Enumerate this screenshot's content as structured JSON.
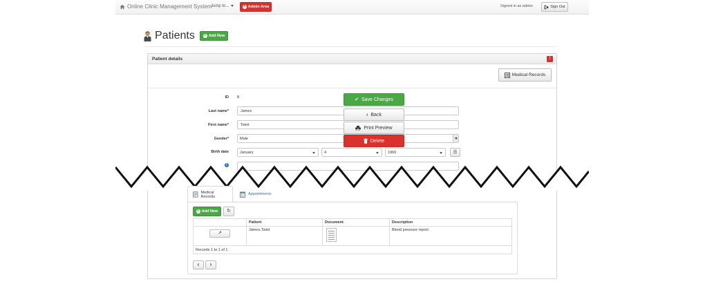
{
  "navbar": {
    "brand": "Online Clinic Management System",
    "jump_label": "Jump to...",
    "admin_label": "Admin Area",
    "signed_in": "Signed in as admin",
    "sign_out": "Sign Out"
  },
  "header": {
    "title": "Patients",
    "add_new": "Add New"
  },
  "panel": {
    "title": "Patient details",
    "alert_glyph": "!",
    "medical_records_button": "Medical Records"
  },
  "form": {
    "id_label": "ID",
    "id_value": "8",
    "last_name_label": "Last name",
    "last_name_value": "James",
    "first_name_label": "First name",
    "first_name_value": "Twist",
    "gender_label": "Gender",
    "gender_value": "Male",
    "required_marker": "*",
    "birth_date_label": "Birth date",
    "birth_month": "January",
    "birth_day": "4",
    "birth_year": "1969"
  },
  "actions": {
    "save": "Save Changes",
    "back": "Back",
    "print": "Print Preview",
    "delete": "Delete"
  },
  "tabs": [
    {
      "label": "Medical Records",
      "active": true
    },
    {
      "label": "Appointments",
      "active": false
    }
  ],
  "records": {
    "add_new": "Add New",
    "columns": [
      "",
      "Patient",
      "Document",
      "Description"
    ],
    "rows": [
      {
        "patient": "James,Twist",
        "description": "Blood pressure report"
      }
    ],
    "footer": "Records 1 to 1 of 1"
  },
  "colors": {
    "success": "#4aa845",
    "danger": "#d9322c",
    "link": "#2a6ebb"
  },
  "icons": {
    "brand": "home-icon",
    "header": "person-icon",
    "tab_records": "document-icon",
    "tab_appointments": "calendar-icon"
  }
}
